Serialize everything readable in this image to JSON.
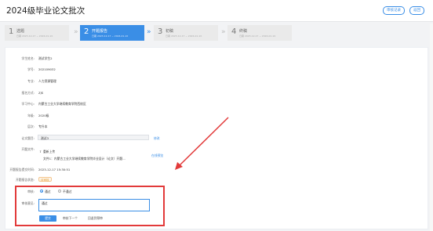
{
  "header": {
    "title": "2024级毕业论文批次",
    "buttons": [
      {
        "label": "审核记录"
      },
      {
        "label": "返回"
      }
    ]
  },
  "steps": [
    {
      "number": "1",
      "title": "选题",
      "sub": "日期 2023-12-17 ~ 2024-01-10",
      "active": false
    },
    {
      "number": "2",
      "title": "开题报告",
      "sub": "日期 2023-12-17 ~ 2024-01-10",
      "active": true
    },
    {
      "number": "3",
      "title": "初稿",
      "sub": "日期 2023-12-17 ~ 2024-01-10",
      "active": false
    },
    {
      "number": "4",
      "title": "终稿",
      "sub": "日期 2023-12-17 ~ 2024-01-10",
      "active": false
    }
  ],
  "fields": [
    {
      "label": "学生姓名:",
      "value": "测试学生2"
    },
    {
      "label": "学号:",
      "value": "202109032"
    },
    {
      "label": "专业:",
      "value": "人力资源管理"
    },
    {
      "label": "报名方式:",
      "value": "ZJS"
    },
    {
      "label": "学习中心:",
      "value": "内蒙古工业大学继续教育学院西校区"
    },
    {
      "label": "年级:",
      "value": "2020级"
    },
    {
      "label": "层次:",
      "value": "专升本"
    }
  ],
  "topic": {
    "label": "论文题目:",
    "value": "测试3",
    "link": "修改"
  },
  "report": {
    "label": "开题文件:",
    "upload_label": "重新上传",
    "file_name": "文件1：内蒙古工业大学继续教育学院毕业设计（论文）开题...",
    "link": "在线预览"
  },
  "submit_time": {
    "label": "开题报告提交时间:",
    "value": "2023-12-17 15:30:51"
  },
  "status": {
    "label": "开题报告状态:",
    "value": "待审核"
  },
  "review": {
    "label": "审核:",
    "options": [
      {
        "label": "通过",
        "selected": true
      },
      {
        "label": "不通过",
        "selected": false
      }
    ],
    "opinion_label": "审核意见:",
    "opinion_value": "通过",
    "submit_label": "提交",
    "next_label": "审核下一个",
    "back_label": "回退到预审"
  },
  "colors": {
    "primary": "#3a8ee6",
    "highlight": "#e23a3a",
    "pending": "#e6a23c"
  }
}
